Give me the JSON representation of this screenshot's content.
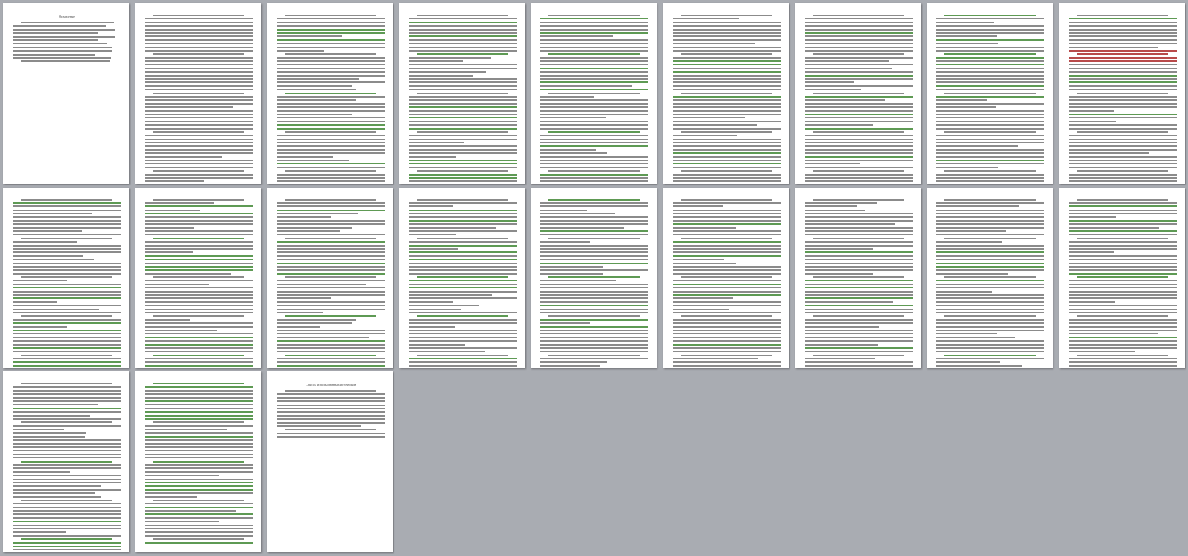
{
  "viewer": {
    "background": "#a9acb2"
  },
  "toc": {
    "title": "Оглавление"
  },
  "references": {
    "title": "Список использованных источников"
  }
}
